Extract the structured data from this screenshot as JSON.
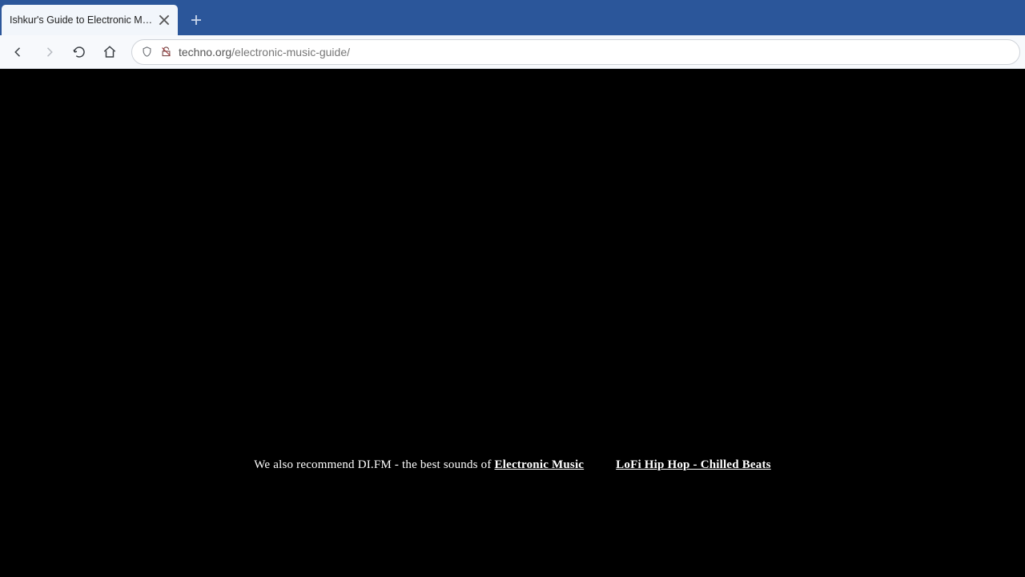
{
  "browser": {
    "tab_title": "Ishkur's Guide to Electronic Music | ",
    "url_host": "techno.org",
    "url_path": "/electronic-music-guide/",
    "new_tab_label": "+"
  },
  "footer": {
    "lead": "We also recommend DI.FM - the best sounds of ",
    "link1": "Electronic Music",
    "link2": "LoFi Hip Hop - Chilled Beats"
  }
}
